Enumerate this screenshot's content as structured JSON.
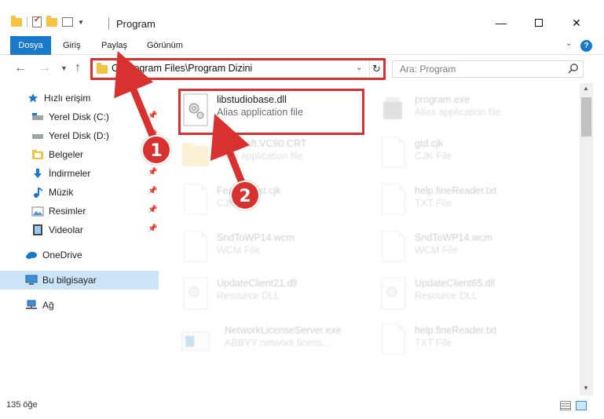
{
  "window": {
    "title": "Program",
    "minimize_glyph": "—",
    "close_glyph": "✕"
  },
  "ribbon": {
    "tabs": [
      {
        "label": "Dosya"
      },
      {
        "label": "Giriş"
      },
      {
        "label": "Paylaş"
      },
      {
        "label": "Görünüm"
      }
    ],
    "help_glyph": "?"
  },
  "address_bar": {
    "path": "C:\\Program Files\\Program Dizini"
  },
  "search": {
    "placeholder": "Ara: Program"
  },
  "sidebar": {
    "items": [
      {
        "label": "Hızlı erişim",
        "icon": "star-icon"
      },
      {
        "label": "Yerel Disk (C:)",
        "icon": "drive-icon"
      },
      {
        "label": "Yerel Disk (D:)",
        "icon": "drive-icon"
      },
      {
        "label": "Belgeler",
        "icon": "documents-folder-icon"
      },
      {
        "label": "İndirmeler",
        "icon": "download-icon"
      },
      {
        "label": "Müzik",
        "icon": "music-icon"
      },
      {
        "label": "Resimler",
        "icon": "pictures-icon"
      },
      {
        "label": "Videolar",
        "icon": "video-icon"
      },
      {
        "label": "OneDrive",
        "icon": "cloud-icon"
      },
      {
        "label": "Bu bilgisayar",
        "icon": "computer-icon"
      },
      {
        "label": "Ağ",
        "icon": "network-icon"
      }
    ]
  },
  "files": [
    {
      "name": "libstudiobase.dll",
      "desc": "Alias application file",
      "icon": "dll-gear-icon"
    },
    {
      "name": "program.exe",
      "desc": "Alias application file",
      "icon": "exe-icon"
    },
    {
      "name": "Microsoft.VC90.CRT",
      "desc": "Alias application file",
      "icon": "folder-icon"
    },
    {
      "name": "gtd.cjk",
      "desc": "CJK File",
      "icon": "file-icon"
    },
    {
      "name": "FeatureList.cjk",
      "desc": "CJK File",
      "icon": "file-icon"
    },
    {
      "name": "help.fineReader.txt",
      "desc": "TXT File",
      "icon": "file-icon"
    },
    {
      "name": "SndToWP14.wcm",
      "desc": "WCM File",
      "icon": "file-icon"
    },
    {
      "name": "SndToWP14.wcm",
      "desc": "WCM File",
      "icon": "file-icon"
    },
    {
      "name": "UpdateClient21.dll",
      "desc": "Resource DLL",
      "icon": "dll-gear-icon"
    },
    {
      "name": "UpdateClient65.dll",
      "desc": "Resource DLL",
      "icon": "dll-gear-icon"
    },
    {
      "name": "NetworkLicenseServer.exe",
      "desc": "ABBYY network licens...",
      "icon": "exe-icon"
    },
    {
      "name": "help.fineReader.txt",
      "desc": "TXT File",
      "icon": "file-icon"
    }
  ],
  "status": {
    "item_count": "135 öğe"
  },
  "callouts": {
    "one": "1",
    "two": "2"
  },
  "colors": {
    "accent": "#1979ca",
    "annotation_red": "#d8312f",
    "selection": "#cce4f7",
    "folder": "#f5c242"
  }
}
